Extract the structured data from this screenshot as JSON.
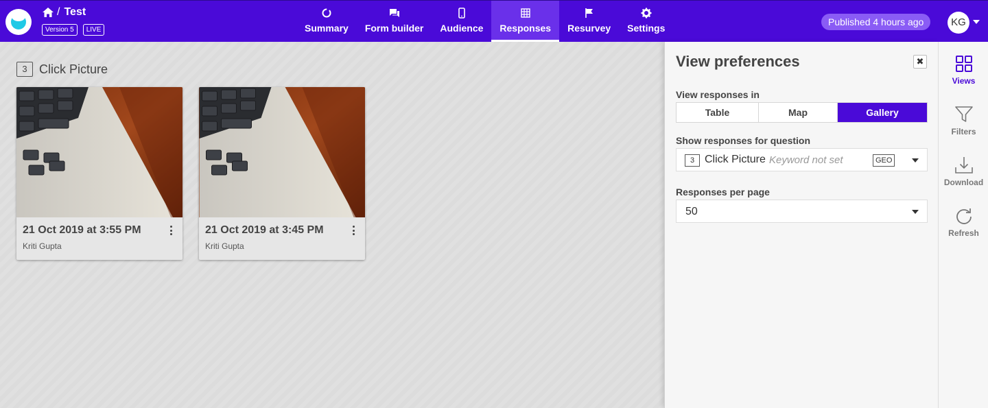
{
  "app": {
    "project_title": "Test",
    "version_badge": "Version 5",
    "live_badge": "LIVE",
    "published_status": "Published 4 hours ago",
    "user_initials": "KG",
    "brand_color": "#4a0ad8"
  },
  "nav": {
    "tabs": [
      {
        "label": "Summary",
        "icon": "summary-icon"
      },
      {
        "label": "Form builder",
        "icon": "chat-icon"
      },
      {
        "label": "Audience",
        "icon": "phone-icon"
      },
      {
        "label": "Responses",
        "icon": "grid-icon",
        "active": true
      },
      {
        "label": "Resurvey",
        "icon": "flag-icon"
      },
      {
        "label": "Settings",
        "icon": "gear-icon"
      }
    ]
  },
  "gallery": {
    "question_number": "3",
    "question_title": "Click Picture",
    "cards": [
      {
        "date": "21 Oct 2019 at 3:55 PM",
        "user": "Kriti Gupta"
      },
      {
        "date": "21 Oct 2019 at 3:45 PM",
        "user": "Kriti Gupta"
      }
    ]
  },
  "preferences": {
    "title": "View preferences",
    "close_label": "✖",
    "view_in_label": "View responses in",
    "view_options": [
      "Table",
      "Map",
      "Gallery"
    ],
    "selected_view": "Gallery",
    "question_label": "Show responses for question",
    "question_select": {
      "number": "3",
      "name": "Click Picture",
      "keyword": "Keyword not set",
      "tag": "GEO"
    },
    "per_page_label": "Responses per page",
    "per_page_value": "50"
  },
  "rail": {
    "items": [
      {
        "label": "Views",
        "icon": "views-icon",
        "active": true
      },
      {
        "label": "Filters",
        "icon": "filter-icon"
      },
      {
        "label": "Download",
        "icon": "download-icon"
      },
      {
        "label": "Refresh",
        "icon": "refresh-icon"
      }
    ]
  }
}
